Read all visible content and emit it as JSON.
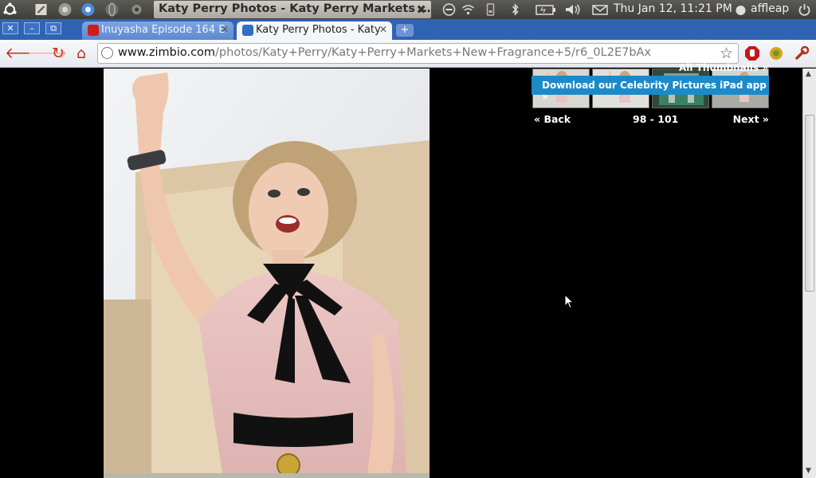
{
  "system_panel": {
    "window_title": "Katy Perry Photos - Katy Perry Markets …",
    "clock": "Thu Jan 12, 11:21 PM",
    "user": "affleap"
  },
  "tabs": [
    {
      "label": "Inuyasha Episode 164 E",
      "active": false
    },
    {
      "label": "Katy Perry Photos - Katy",
      "active": true
    }
  ],
  "toolbar": {
    "url_host": "www.zimbio.com",
    "url_path": "/photos/Katy+Perry/Katy+Perry+Markets+New+Fragrance+5/r6_0L2E7bAx"
  },
  "gallery": {
    "back_label": "Back",
    "range": "98 - 101",
    "next_label": "Next",
    "all_thumbnails_label": "All Thumbnails »",
    "app_banner": "Download our Celebrity Pictures iPad app »"
  },
  "colors": {
    "tab_strip": "#2f63b4",
    "app_banner": "#1c8ac9",
    "page_bg": "#000000"
  }
}
